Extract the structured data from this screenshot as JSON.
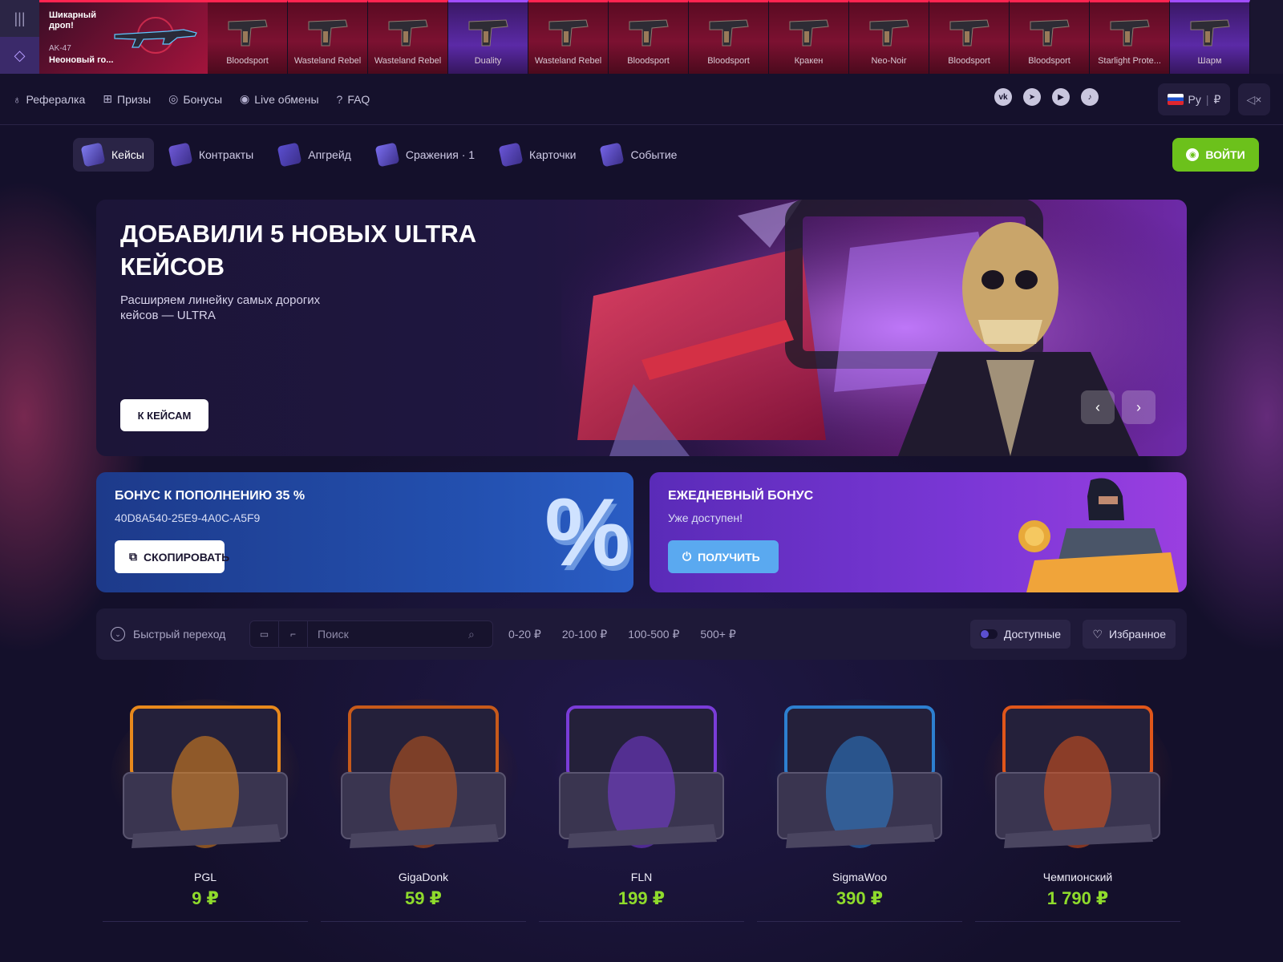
{
  "live_drops": {
    "featured": {
      "title": "Шикарный дроп!",
      "weapon": "AK-47",
      "skin": "Неоновый го..."
    },
    "items": [
      {
        "name": "Bloodsport",
        "rarity": "red"
      },
      {
        "name": "Wasteland Rebel",
        "rarity": "red"
      },
      {
        "name": "Wasteland Rebel",
        "rarity": "red"
      },
      {
        "name": "Duality",
        "rarity": "purple"
      },
      {
        "name": "Wasteland Rebel",
        "rarity": "red"
      },
      {
        "name": "Bloodsport",
        "rarity": "red"
      },
      {
        "name": "Bloodsport",
        "rarity": "red"
      },
      {
        "name": "Кракен",
        "rarity": "red"
      },
      {
        "name": "Neo-Noir",
        "rarity": "red"
      },
      {
        "name": "Bloodsport",
        "rarity": "red"
      },
      {
        "name": "Bloodsport",
        "rarity": "red"
      },
      {
        "name": "Starlight Prote...",
        "rarity": "red"
      },
      {
        "name": "Шарм",
        "rarity": "purple"
      }
    ]
  },
  "topnav": {
    "links": [
      {
        "label": "Рефералка",
        "icon": "medal-icon"
      },
      {
        "label": "Призы",
        "icon": "gift-icon"
      },
      {
        "label": "Бонусы",
        "icon": "coin-icon"
      },
      {
        "label": "Live обмены",
        "icon": "exchange-icon"
      },
      {
        "label": "FAQ",
        "icon": "question-icon"
      }
    ],
    "socials": [
      "vk-icon",
      "telegram-icon",
      "youtube-icon",
      "tiktok-icon"
    ],
    "language": "Ру",
    "currency": "₽"
  },
  "mainnav": {
    "items": [
      {
        "label": "Кейсы",
        "icon": "case-icon",
        "active": true
      },
      {
        "label": "Контракты",
        "icon": "contract-icon",
        "active": false
      },
      {
        "label": "Апгрейд",
        "icon": "upgrade-icon",
        "active": false
      },
      {
        "label": "Сражения · 1",
        "icon": "battle-icon",
        "active": false
      },
      {
        "label": "Карточки",
        "icon": "cards-icon",
        "active": false
      },
      {
        "label": "Событие",
        "icon": "event-icon",
        "active": false
      }
    ],
    "login_label": "ВОЙТИ"
  },
  "hero": {
    "title": "ДОБАВИЛИ 5 НОВЫХ ULTRA КЕЙСОВ",
    "subtitle": "Расширяем линейку самых дорогих кейсов — ULTRA",
    "button": "К КЕЙСАМ"
  },
  "bonuses": {
    "deposit": {
      "title": "БОНУС К ПОПОЛНЕНИЮ 35 %",
      "code": "40D8A540-25E9-4A0C-A5F9",
      "button": "СКОПИРОВАТЬ",
      "graphic": "%"
    },
    "daily": {
      "title": "ЕЖЕДНЕВНЫЙ БОНУС",
      "status": "Уже доступен!",
      "button": "ПОЛУЧИТЬ"
    }
  },
  "filter": {
    "quick_jump": "Быстрый переход",
    "search_placeholder": "Поиск",
    "ranges": [
      "0-20 ₽",
      "20-100 ₽",
      "100-500 ₽",
      "500+ ₽"
    ],
    "available_label": "Доступные",
    "favorites_label": "Избранное"
  },
  "cases": [
    {
      "name": "PGL",
      "price": "9 ₽",
      "theme": "#e8891c"
    },
    {
      "name": "GigaDonk",
      "price": "59 ₽",
      "theme": "#c75a1a"
    },
    {
      "name": "FLN",
      "price": "199 ₽",
      "theme": "#7a3cd8"
    },
    {
      "name": "SigmaWoo",
      "price": "390 ₽",
      "theme": "#2d7fd0"
    },
    {
      "name": "Чемпионский",
      "price": "1 790 ₽",
      "theme": "#e0561a"
    }
  ],
  "colors": {
    "accent_green": "#6cc11b",
    "price_green": "#8fdb2c",
    "rarity_red": "#ff2450",
    "rarity_purple": "#a14dff",
    "background": "#14102b"
  }
}
